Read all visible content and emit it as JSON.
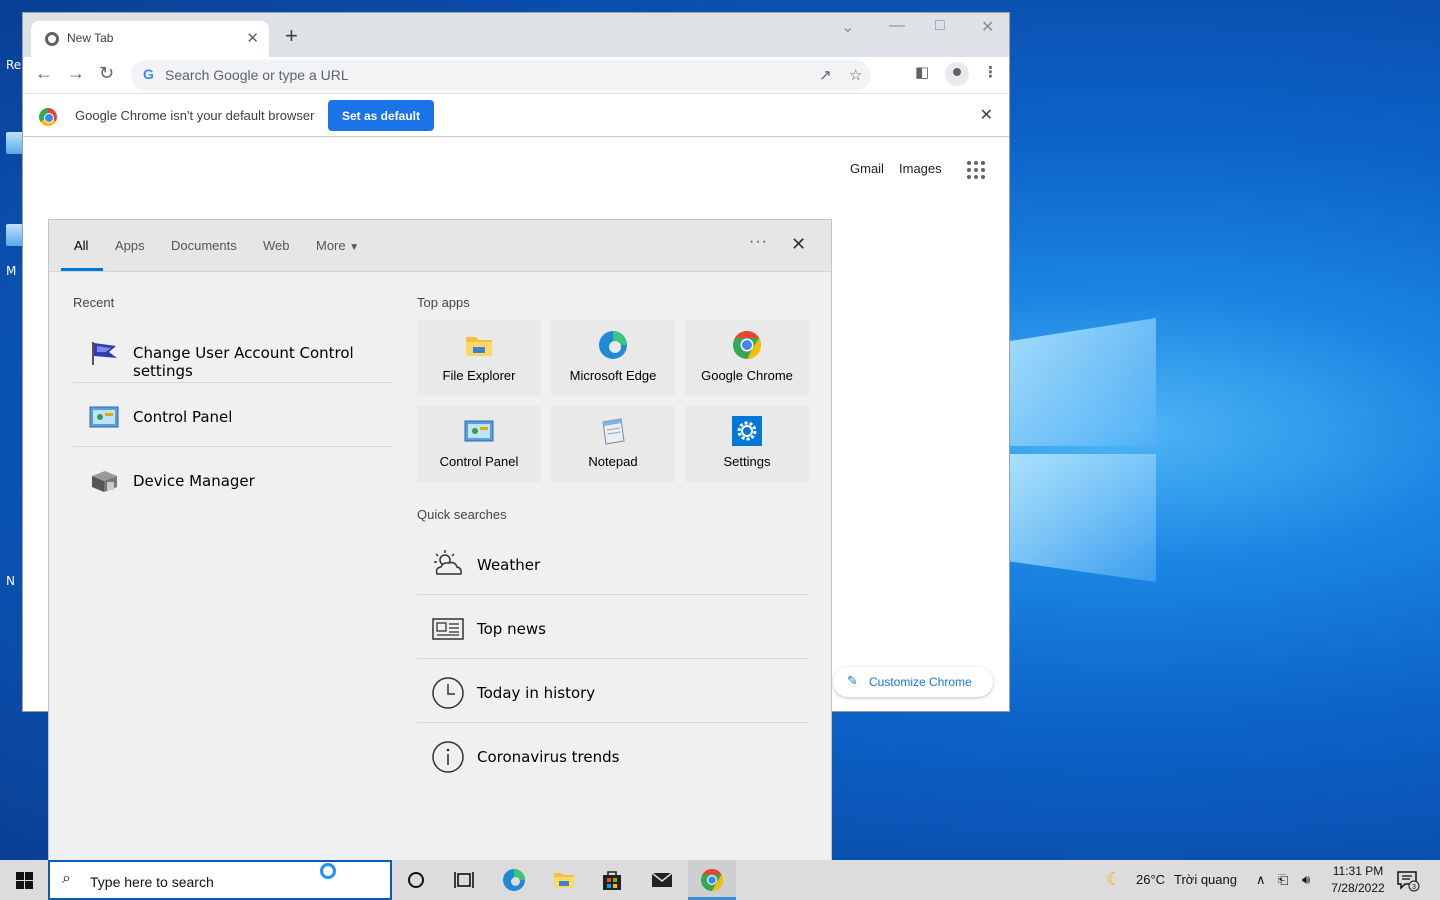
{
  "browser": {
    "tab_title": "New Tab",
    "tab_close": "✕",
    "new_tab": "+",
    "omnibox_placeholder": "Search Google or type a URL",
    "infobar_message": "Google Chrome isn't your default browser",
    "set_default_label": "Set as default",
    "infobar_close": "✕",
    "gmail": "Gmail",
    "images": "Images",
    "customize_label": "Customize Chrome"
  },
  "search_panel": {
    "tabs": [
      "All",
      "Apps",
      "Documents",
      "Web",
      "More"
    ],
    "active_tab": "All",
    "recent_title": "Recent",
    "recent": [
      {
        "label": "Change User Account Control settings",
        "icon": "uac-flag-icon"
      },
      {
        "label": "Control Panel",
        "icon": "control-panel-icon"
      },
      {
        "label": "Device Manager",
        "icon": "device-manager-icon"
      }
    ],
    "top_apps_title": "Top apps",
    "top_apps": [
      {
        "label": "File Explorer",
        "icon": "file-explorer-icon"
      },
      {
        "label": "Microsoft Edge",
        "icon": "edge-icon"
      },
      {
        "label": "Google Chrome",
        "icon": "chrome-icon"
      },
      {
        "label": "Control Panel",
        "icon": "control-panel-icon"
      },
      {
        "label": "Notepad",
        "icon": "notepad-icon"
      },
      {
        "label": "Settings",
        "icon": "settings-gear-icon"
      }
    ],
    "quick_title": "Quick searches",
    "quick": [
      {
        "label": "Weather",
        "icon": "weather-icon"
      },
      {
        "label": "Top news",
        "icon": "news-icon"
      },
      {
        "label": "Today in history",
        "icon": "clock-icon"
      },
      {
        "label": "Coronavirus trends",
        "icon": "info-icon"
      }
    ]
  },
  "taskbar": {
    "search_placeholder": "Type here to search",
    "weather_temp": "26°C",
    "weather_desc": "Trời quang",
    "time": "11:31 PM",
    "date": "7/28/2022",
    "notification_count": "3"
  },
  "desktop": {
    "label_fragments": [
      "Re",
      "M",
      "N",
      "N"
    ]
  },
  "colors": {
    "accent_blue": "#1a73e8",
    "windows_accent": "#0078d7"
  }
}
